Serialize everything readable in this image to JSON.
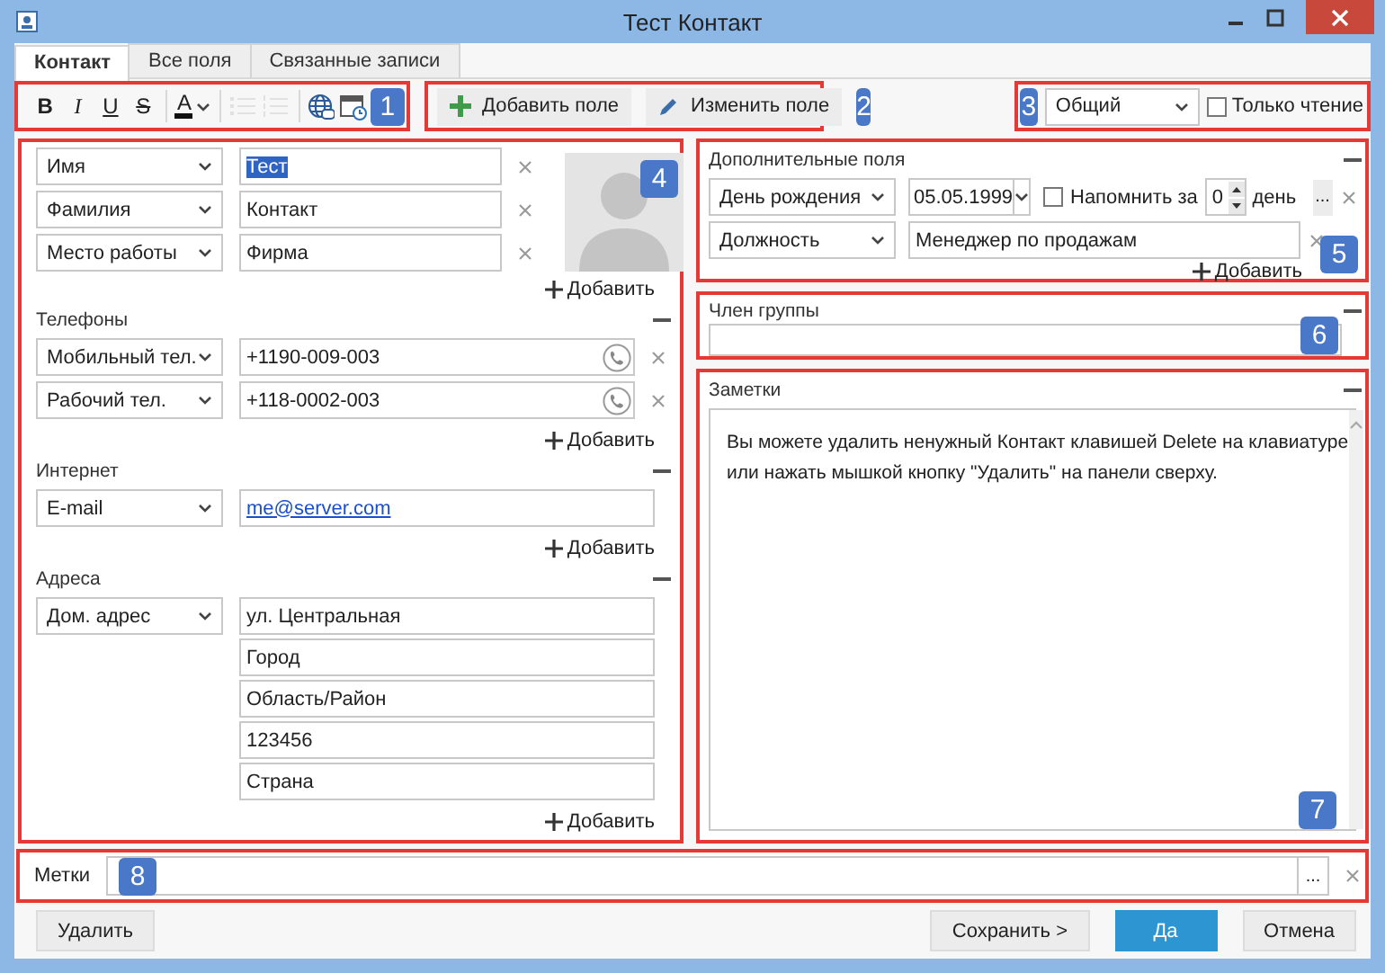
{
  "window": {
    "title": "Тест Контакт"
  },
  "tabs": [
    {
      "label": "Контакт",
      "selected": true
    },
    {
      "label": "Все поля",
      "selected": false
    },
    {
      "label": "Связанные записи",
      "selected": false
    }
  ],
  "format_toolbar": {
    "callout": "1",
    "buttons": [
      {
        "kind": "bold",
        "label": "B",
        "disabled": false
      },
      {
        "kind": "italic",
        "label": "I",
        "disabled": false
      },
      {
        "kind": "underline",
        "label": "U",
        "disabled": false
      },
      {
        "kind": "strike",
        "label": "S",
        "disabled": false
      },
      {
        "kind": "color",
        "label": "A",
        "disabled": false
      },
      {
        "kind": "bullets",
        "disabled": true
      },
      {
        "kind": "numbering",
        "disabled": true
      },
      {
        "kind": "link",
        "disabled": false
      },
      {
        "kind": "calendar",
        "disabled": false
      }
    ]
  },
  "field_toolbar": {
    "callout": "2",
    "buttons": [
      {
        "kind": "add",
        "label": "Добавить поле"
      },
      {
        "kind": "edit",
        "label": "Изменить поле"
      }
    ]
  },
  "view": {
    "callout": "3",
    "select": "Общий",
    "read_only": {
      "label": "Только чтение",
      "checked": false
    }
  },
  "main": {
    "callout": "4",
    "name_rows": [
      {
        "type": "Имя",
        "value": "Тест",
        "highlighted": true
      },
      {
        "type": "Фамилия",
        "value": "Контакт",
        "highlighted": false
      },
      {
        "type": "Место работы",
        "value": "Фирма",
        "highlighted": false
      }
    ],
    "add": "Добавить",
    "sections": [
      {
        "title": "Телефоны",
        "rows": [
          {
            "kind": "phone",
            "type": "Мобильный тел.",
            "value": "+1190-009-003"
          },
          {
            "kind": "phone",
            "type": "Рабочий тел.",
            "value": "+118-0002-003"
          }
        ],
        "add": "Добавить"
      },
      {
        "title": "Интернет",
        "rows": [
          {
            "kind": "email",
            "type": "E-mail",
            "value": "me@server.com"
          }
        ],
        "add": "Добавить"
      },
      {
        "title": "Адреса",
        "rows": [
          {
            "kind": "address",
            "type": "Дом. адрес",
            "lines": [
              "ул. Центральная",
              "Город",
              "Область/Район",
              "123456",
              "Страна"
            ]
          }
        ],
        "add": "Добавить"
      }
    ]
  },
  "extra_fields": {
    "callout": "5",
    "title": "Дополнительные поля",
    "rows": [
      {
        "kind": "date",
        "type": "День рождения",
        "value": "05.05.1999",
        "remind": {
          "label": "Напомнить за",
          "checked": false,
          "value": "0",
          "unit": "день",
          "more": "..."
        }
      },
      {
        "kind": "text",
        "type": "Должность",
        "value": "Менеджер по продажам"
      }
    ],
    "add": "Добавить"
  },
  "group": {
    "callout": "6",
    "title": "Член группы"
  },
  "notes": {
    "callout": "7",
    "title": "Заметки",
    "text": "Вы можете удалить ненужный Контакт клавишей Delete на клавиатуре\nили нажать мышкой кнопку \"Удалить\" на панели сверху."
  },
  "tags": {
    "callout": "8",
    "label": "Метки",
    "more": "..."
  },
  "buttons": [
    {
      "kind": "normal",
      "label": "Удалить"
    },
    {
      "kind": "normal",
      "label": "Сохранить >"
    },
    {
      "kind": "primary",
      "label": "Да"
    },
    {
      "kind": "normal",
      "label": "Отмена"
    }
  ]
}
